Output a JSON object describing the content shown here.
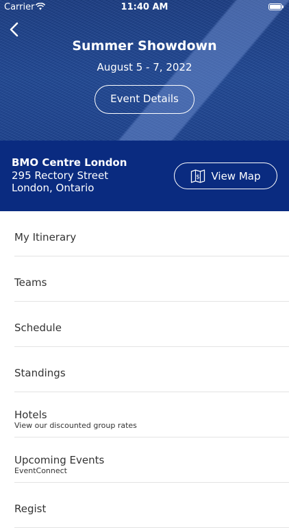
{
  "status_bar": {
    "carrier": "Carrier",
    "time": "11:40 AM"
  },
  "header": {
    "title": "Summer Showdown",
    "dates": "August 5 - 7, 2022",
    "details_button": "Event Details"
  },
  "venue": {
    "name": "BMO Centre London",
    "address_line1": "295 Rectory Street",
    "address_line2": "London, Ontario",
    "map_button": "View Map"
  },
  "menu": [
    {
      "label": "My Itinerary"
    },
    {
      "label": "Teams"
    },
    {
      "label": "Schedule"
    },
    {
      "label": "Standings"
    },
    {
      "label": "Hotels",
      "sublabel": "View our discounted group rates"
    },
    {
      "label": "Upcoming Events",
      "sublabel": "EventConnect"
    },
    {
      "label": "Regist"
    }
  ]
}
